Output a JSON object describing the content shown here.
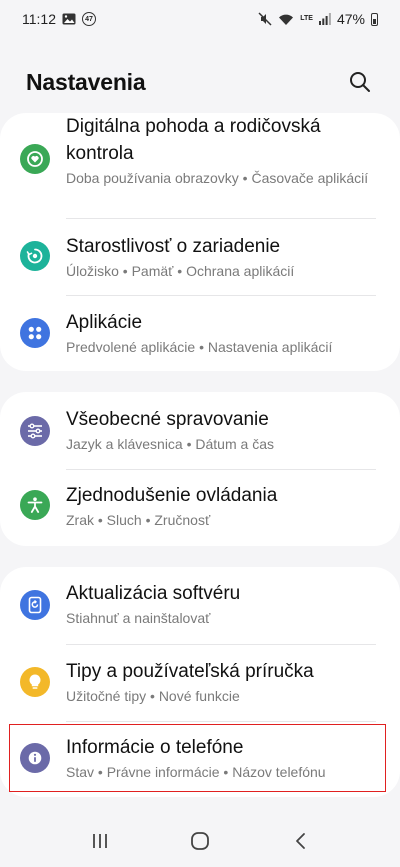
{
  "status_bar": {
    "time": "11:12",
    "notification_count": "47",
    "battery_percent": "47%",
    "network": "LTE"
  },
  "header": {
    "title": "Nastavenia",
    "search_icon": "search-icon"
  },
  "groups": [
    {
      "items": [
        {
          "label": "Digitálna pohoda a rodičovská kontrola",
          "subtitle": "Doba používania obrazovky • Časovače aplikácií",
          "icon": "heart-icon",
          "color": "#3aa856"
        },
        {
          "label": "Starostlivosť o zariadenie",
          "subtitle": "Úložisko • Pamäť • Ochrana aplikácií",
          "icon": "device-care-icon",
          "color": "#1db39a"
        },
        {
          "label": "Aplikácie",
          "subtitle": "Predvolené aplikácie • Nastavenia aplikácií",
          "icon": "apps-icon",
          "color": "#3f74e0"
        }
      ]
    },
    {
      "items": [
        {
          "label": "Všeobecné spravovanie",
          "subtitle": "Jazyk a klávesnica • Dátum a čas",
          "icon": "sliders-icon",
          "color": "#6b6aa8"
        },
        {
          "label": "Zjednodušenie ovládania",
          "subtitle": "Zrak • Sluch • Zručnosť",
          "icon": "accessibility-icon",
          "color": "#3aa856"
        }
      ]
    },
    {
      "items": [
        {
          "label": "Aktualizácia softvéru",
          "subtitle": "Stiahnuť a nainštalovať",
          "icon": "software-update-icon",
          "color": "#3f74e0"
        },
        {
          "label": "Tipy a používateľská príručka",
          "subtitle": "Užitočné tipy • Nové funkcie",
          "icon": "lightbulb-icon",
          "color": "#f3b829"
        },
        {
          "label": "Informácie o telefóne",
          "subtitle": "Stav • Právne informácie • Názov telefónu",
          "icon": "info-icon",
          "color": "#6b6aa8"
        }
      ]
    }
  ],
  "navbar": {
    "recents_icon": "recents-icon",
    "home_icon": "home-icon",
    "back_icon": "back-icon"
  }
}
